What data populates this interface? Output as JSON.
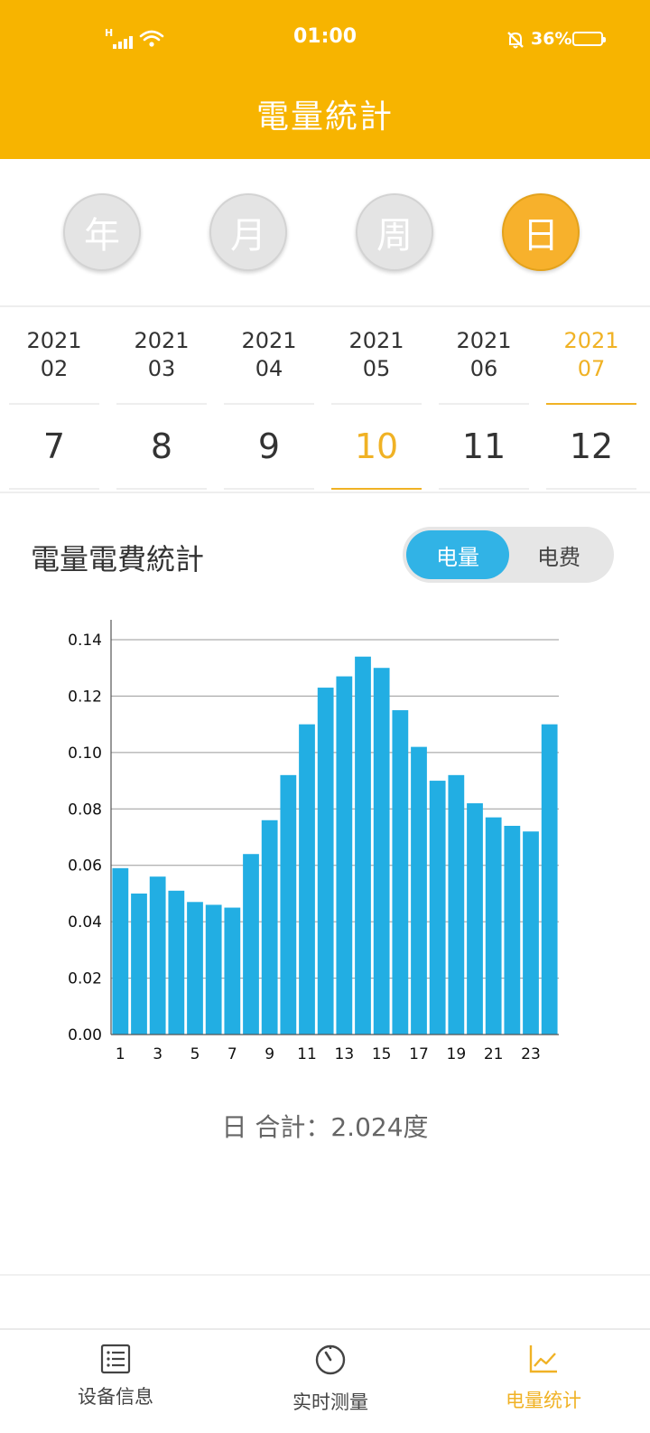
{
  "status_bar": {
    "time": "01:00",
    "network": "H",
    "battery_percent": "36%"
  },
  "header": {
    "title": "電量統計"
  },
  "period_selector": [
    {
      "label": "年",
      "active": false
    },
    {
      "label": "月",
      "active": false
    },
    {
      "label": "周",
      "active": false
    },
    {
      "label": "日",
      "active": true
    }
  ],
  "months": [
    {
      "year": "2021",
      "month": "02",
      "active": false
    },
    {
      "year": "2021",
      "month": "03",
      "active": false
    },
    {
      "year": "2021",
      "month": "04",
      "active": false
    },
    {
      "year": "2021",
      "month": "05",
      "active": false
    },
    {
      "year": "2021",
      "month": "06",
      "active": false
    },
    {
      "year": "2021",
      "month": "07",
      "active": true
    }
  ],
  "days": [
    {
      "label": "7",
      "active": false
    },
    {
      "label": "8",
      "active": false
    },
    {
      "label": "9",
      "active": false
    },
    {
      "label": "10",
      "active": true
    },
    {
      "label": "11",
      "active": false
    },
    {
      "label": "12",
      "active": false
    }
  ],
  "section": {
    "title": "電量電費統計",
    "toggle_power": "电量",
    "toggle_cost": "电费",
    "selected": "电量"
  },
  "chart_data": {
    "type": "bar",
    "categories": [
      "1",
      "2",
      "3",
      "4",
      "5",
      "6",
      "7",
      "8",
      "9",
      "10",
      "11",
      "12",
      "13",
      "14",
      "15",
      "16",
      "17",
      "18",
      "19",
      "20",
      "21",
      "22",
      "23",
      "24"
    ],
    "values": [
      0.059,
      0.05,
      0.056,
      0.051,
      0.047,
      0.046,
      0.045,
      0.064,
      0.076,
      0.092,
      0.11,
      0.123,
      0.127,
      0.134,
      0.13,
      0.115,
      0.102,
      0.09,
      0.092,
      0.082,
      0.077,
      0.074,
      0.072,
      0.11
    ],
    "x_tick_labels": [
      "1",
      "3",
      "5",
      "7",
      "9",
      "11",
      "13",
      "15",
      "17",
      "19",
      "21",
      "23"
    ],
    "y_tick_labels": [
      "0.00",
      "0.02",
      "0.04",
      "0.06",
      "0.08",
      "0.10",
      "0.12",
      "0.14"
    ],
    "ylim": [
      0,
      0.14
    ],
    "grid": true,
    "bar_color": "#22AEE3"
  },
  "total": {
    "text": "日 合計：2.024度"
  },
  "bottom_nav": [
    {
      "label": "设备信息",
      "icon": "list-icon",
      "active": false
    },
    {
      "label": "实时测量",
      "icon": "gauge-icon",
      "active": false
    },
    {
      "label": "电量统计",
      "icon": "line-chart-icon",
      "active": true
    }
  ],
  "colors": {
    "accent": "#F7B400",
    "active_text": "#F0B225",
    "toggle_active": "#31B3E6"
  }
}
